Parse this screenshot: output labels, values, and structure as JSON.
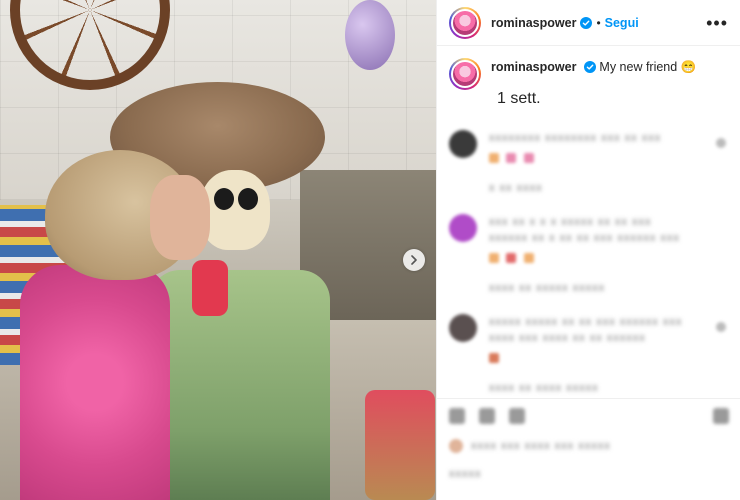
{
  "post": {
    "username": "rominaspower",
    "verified": true,
    "follow_label": "Segui",
    "dot": "•",
    "more_label": "•••",
    "caption": "My new friend",
    "caption_emoji": "😁",
    "time_ago": "1 sett."
  },
  "comments": [
    {
      "text": "xxxxxxxx xxxxxxxx xxx xx xxx",
      "meta": "x xx xxxx"
    },
    {
      "text": "xxx xx x x x xxxxx xx xx xxx xxxxxx xx x xx xx xxx xxxxxx xxx",
      "meta": "xxxx xx xxxxx xxxxx"
    },
    {
      "text": "xxxxx xxxxx xx xx xxx xxxxxx xxx xxxx xxx xxxx xx xx xxxxxx",
      "meta": "xxxx xx xxxx xxxxx"
    }
  ],
  "colors": {
    "follow": "#0095f6",
    "verified": "#0095f6"
  },
  "icons": [
    "chevron-right-icon",
    "verified-badge-icon",
    "more-icon",
    "heart-icon",
    "comment-icon",
    "share-icon",
    "bookmark-icon"
  ]
}
